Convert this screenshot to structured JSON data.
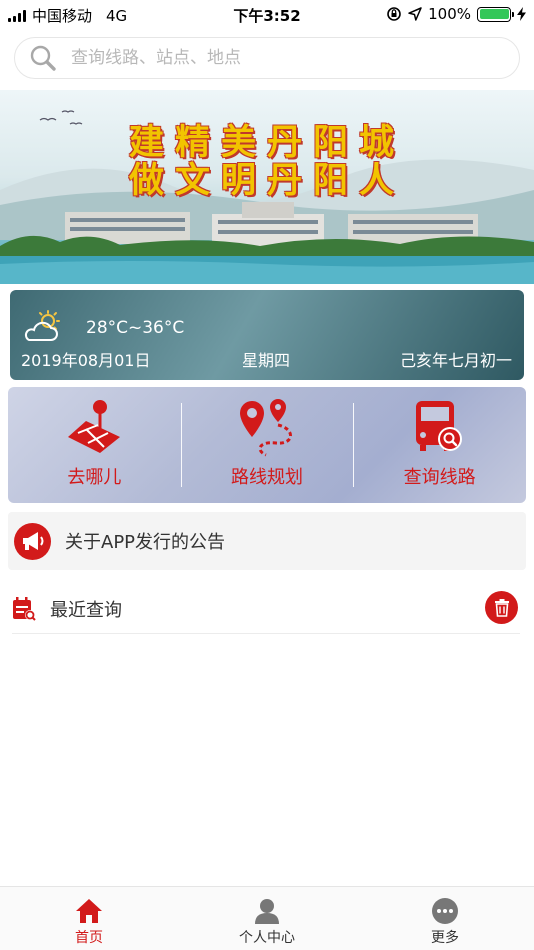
{
  "status_bar": {
    "carrier": "中国移动",
    "network": "4G",
    "time": "下午3:52",
    "battery_percent": "100%",
    "battery_level": 1.0
  },
  "search": {
    "placeholder": "查询线路、站点、地点"
  },
  "banner": {
    "line1": "建精美丹阳城",
    "line2": "做文明丹阳人"
  },
  "weather": {
    "icon": "partly-cloudy-icon",
    "temperature": "28°C~36°C",
    "date": "2019年08月01日",
    "weekday": "星期四",
    "lunar_date": "己亥年七月初一"
  },
  "actions": [
    {
      "label": "去哪儿",
      "icon": "map-pin-icon"
    },
    {
      "label": "路线规划",
      "icon": "route-icon"
    },
    {
      "label": "查询线路",
      "icon": "bus-search-icon"
    }
  ],
  "notice": {
    "text": "关于APP发行的公告",
    "icon": "megaphone-icon"
  },
  "recent": {
    "title": "最近查询",
    "icon": "calendar-search-icon",
    "delete_icon": "trash-icon"
  },
  "tabs": [
    {
      "label": "首页",
      "icon": "home-icon",
      "active": true
    },
    {
      "label": "个人中心",
      "icon": "user-icon",
      "active": false
    },
    {
      "label": "更多",
      "icon": "more-icon",
      "active": false
    }
  ],
  "colors": {
    "accent": "#d21a1a",
    "banner_text": "#f2c400",
    "battery": "#34c759"
  }
}
